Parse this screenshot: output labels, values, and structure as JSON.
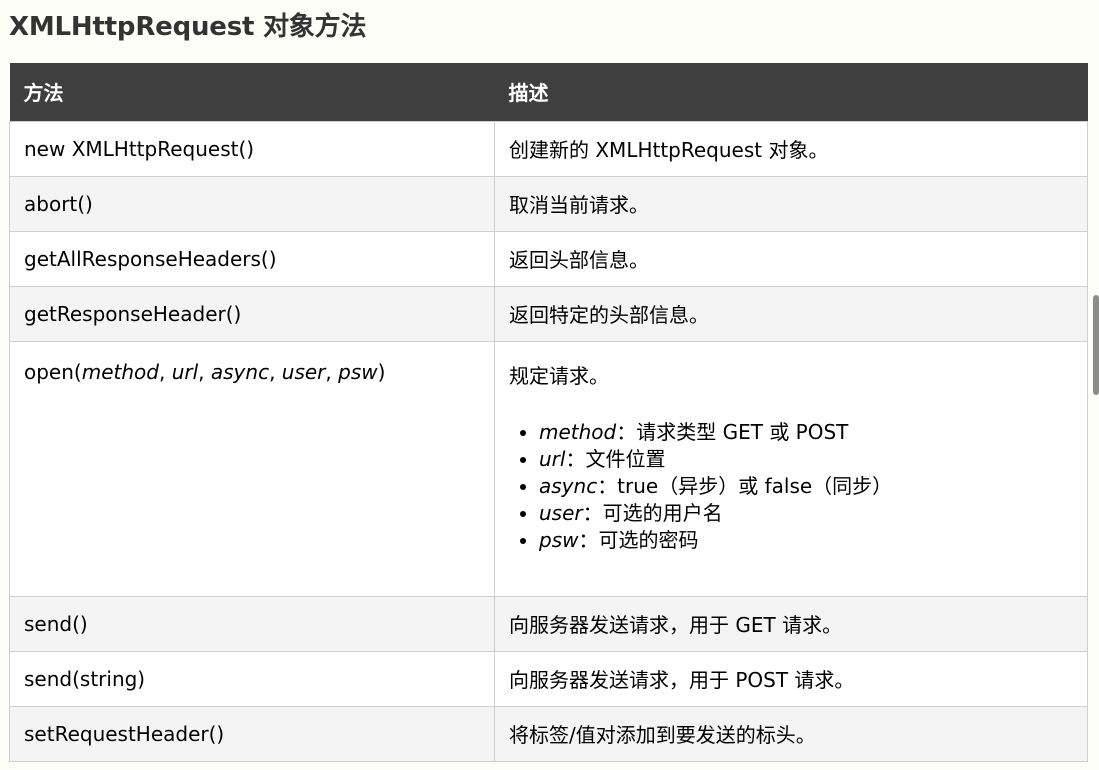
{
  "title": "XMLHttpRequest 对象方法",
  "table": {
    "headers": {
      "method": "方法",
      "description": "描述"
    },
    "rows": [
      {
        "method": "new XMLHttpRequest()",
        "description": "创建新的 XMLHttpRequest 对象。"
      },
      {
        "method": "abort()",
        "description": "取消当前请求。"
      },
      {
        "method": "getAllResponseHeaders()",
        "description": "返回头部信息。"
      },
      {
        "method": "getResponseHeader()",
        "description": "返回特定的头部信息。"
      },
      {
        "method_parts": {
          "name": "open(",
          "p1": "method",
          "s1": ", ",
          "p2": "url",
          "s2": ", ",
          "p3": "async",
          "s3": ", ",
          "p4": "user",
          "s4": ", ",
          "p5": "psw",
          "end": ")"
        },
        "description": "规定请求。",
        "params": [
          {
            "name": "method",
            "desc": "：请求类型 GET 或 POST"
          },
          {
            "name": "url",
            "desc": "：文件位置"
          },
          {
            "name": "async",
            "desc": "：true（异步）或 false（同步）"
          },
          {
            "name": "user",
            "desc": "：可选的用户名"
          },
          {
            "name": "psw",
            "desc": "：可选的密码"
          }
        ]
      },
      {
        "method": "send()",
        "description": "向服务器发送请求，用于 GET 请求。"
      },
      {
        "method": "send(string)",
        "description": "向服务器发送请求，用于 POST 请求。"
      },
      {
        "method": "setRequestHeader()",
        "description": "将标签/值对添加到要发送的标头。"
      }
    ]
  }
}
